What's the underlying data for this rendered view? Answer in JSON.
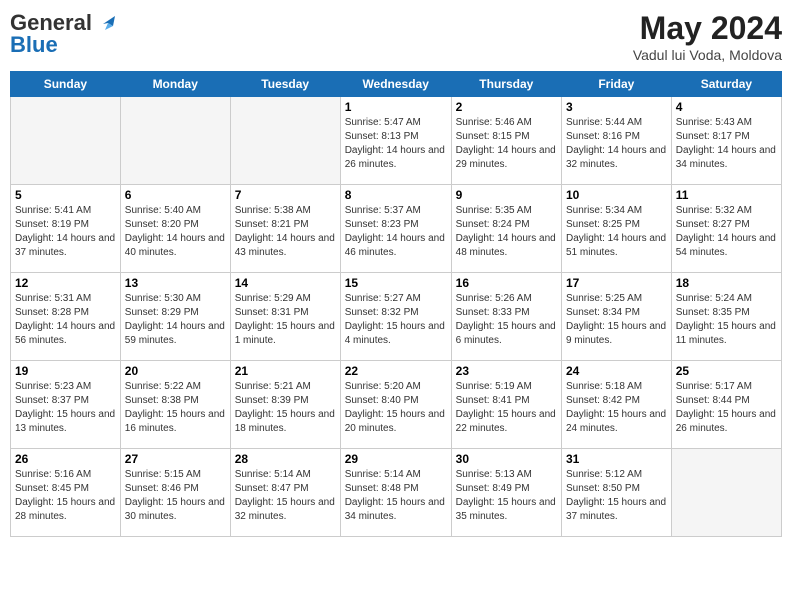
{
  "header": {
    "logo_line1": "General",
    "logo_line2": "Blue",
    "month": "May 2024",
    "location": "Vadul lui Voda, Moldova"
  },
  "weekdays": [
    "Sunday",
    "Monday",
    "Tuesday",
    "Wednesday",
    "Thursday",
    "Friday",
    "Saturday"
  ],
  "weeks": [
    [
      {
        "day": "",
        "empty": true
      },
      {
        "day": "",
        "empty": true
      },
      {
        "day": "",
        "empty": true
      },
      {
        "day": "1",
        "sunrise": "5:47 AM",
        "sunset": "8:13 PM",
        "daylight": "14 hours and 26 minutes."
      },
      {
        "day": "2",
        "sunrise": "5:46 AM",
        "sunset": "8:15 PM",
        "daylight": "14 hours and 29 minutes."
      },
      {
        "day": "3",
        "sunrise": "5:44 AM",
        "sunset": "8:16 PM",
        "daylight": "14 hours and 32 minutes."
      },
      {
        "day": "4",
        "sunrise": "5:43 AM",
        "sunset": "8:17 PM",
        "daylight": "14 hours and 34 minutes."
      }
    ],
    [
      {
        "day": "5",
        "sunrise": "5:41 AM",
        "sunset": "8:19 PM",
        "daylight": "14 hours and 37 minutes."
      },
      {
        "day": "6",
        "sunrise": "5:40 AM",
        "sunset": "8:20 PM",
        "daylight": "14 hours and 40 minutes."
      },
      {
        "day": "7",
        "sunrise": "5:38 AM",
        "sunset": "8:21 PM",
        "daylight": "14 hours and 43 minutes."
      },
      {
        "day": "8",
        "sunrise": "5:37 AM",
        "sunset": "8:23 PM",
        "daylight": "14 hours and 46 minutes."
      },
      {
        "day": "9",
        "sunrise": "5:35 AM",
        "sunset": "8:24 PM",
        "daylight": "14 hours and 48 minutes."
      },
      {
        "day": "10",
        "sunrise": "5:34 AM",
        "sunset": "8:25 PM",
        "daylight": "14 hours and 51 minutes."
      },
      {
        "day": "11",
        "sunrise": "5:32 AM",
        "sunset": "8:27 PM",
        "daylight": "14 hours and 54 minutes."
      }
    ],
    [
      {
        "day": "12",
        "sunrise": "5:31 AM",
        "sunset": "8:28 PM",
        "daylight": "14 hours and 56 minutes."
      },
      {
        "day": "13",
        "sunrise": "5:30 AM",
        "sunset": "8:29 PM",
        "daylight": "14 hours and 59 minutes."
      },
      {
        "day": "14",
        "sunrise": "5:29 AM",
        "sunset": "8:31 PM",
        "daylight": "15 hours and 1 minute."
      },
      {
        "day": "15",
        "sunrise": "5:27 AM",
        "sunset": "8:32 PM",
        "daylight": "15 hours and 4 minutes."
      },
      {
        "day": "16",
        "sunrise": "5:26 AM",
        "sunset": "8:33 PM",
        "daylight": "15 hours and 6 minutes."
      },
      {
        "day": "17",
        "sunrise": "5:25 AM",
        "sunset": "8:34 PM",
        "daylight": "15 hours and 9 minutes."
      },
      {
        "day": "18",
        "sunrise": "5:24 AM",
        "sunset": "8:35 PM",
        "daylight": "15 hours and 11 minutes."
      }
    ],
    [
      {
        "day": "19",
        "sunrise": "5:23 AM",
        "sunset": "8:37 PM",
        "daylight": "15 hours and 13 minutes."
      },
      {
        "day": "20",
        "sunrise": "5:22 AM",
        "sunset": "8:38 PM",
        "daylight": "15 hours and 16 minutes."
      },
      {
        "day": "21",
        "sunrise": "5:21 AM",
        "sunset": "8:39 PM",
        "daylight": "15 hours and 18 minutes."
      },
      {
        "day": "22",
        "sunrise": "5:20 AM",
        "sunset": "8:40 PM",
        "daylight": "15 hours and 20 minutes."
      },
      {
        "day": "23",
        "sunrise": "5:19 AM",
        "sunset": "8:41 PM",
        "daylight": "15 hours and 22 minutes."
      },
      {
        "day": "24",
        "sunrise": "5:18 AM",
        "sunset": "8:42 PM",
        "daylight": "15 hours and 24 minutes."
      },
      {
        "day": "25",
        "sunrise": "5:17 AM",
        "sunset": "8:44 PM",
        "daylight": "15 hours and 26 minutes."
      }
    ],
    [
      {
        "day": "26",
        "sunrise": "5:16 AM",
        "sunset": "8:45 PM",
        "daylight": "15 hours and 28 minutes."
      },
      {
        "day": "27",
        "sunrise": "5:15 AM",
        "sunset": "8:46 PM",
        "daylight": "15 hours and 30 minutes."
      },
      {
        "day": "28",
        "sunrise": "5:14 AM",
        "sunset": "8:47 PM",
        "daylight": "15 hours and 32 minutes."
      },
      {
        "day": "29",
        "sunrise": "5:14 AM",
        "sunset": "8:48 PM",
        "daylight": "15 hours and 34 minutes."
      },
      {
        "day": "30",
        "sunrise": "5:13 AM",
        "sunset": "8:49 PM",
        "daylight": "15 hours and 35 minutes."
      },
      {
        "day": "31",
        "sunrise": "5:12 AM",
        "sunset": "8:50 PM",
        "daylight": "15 hours and 37 minutes."
      },
      {
        "day": "",
        "empty": true
      }
    ]
  ]
}
